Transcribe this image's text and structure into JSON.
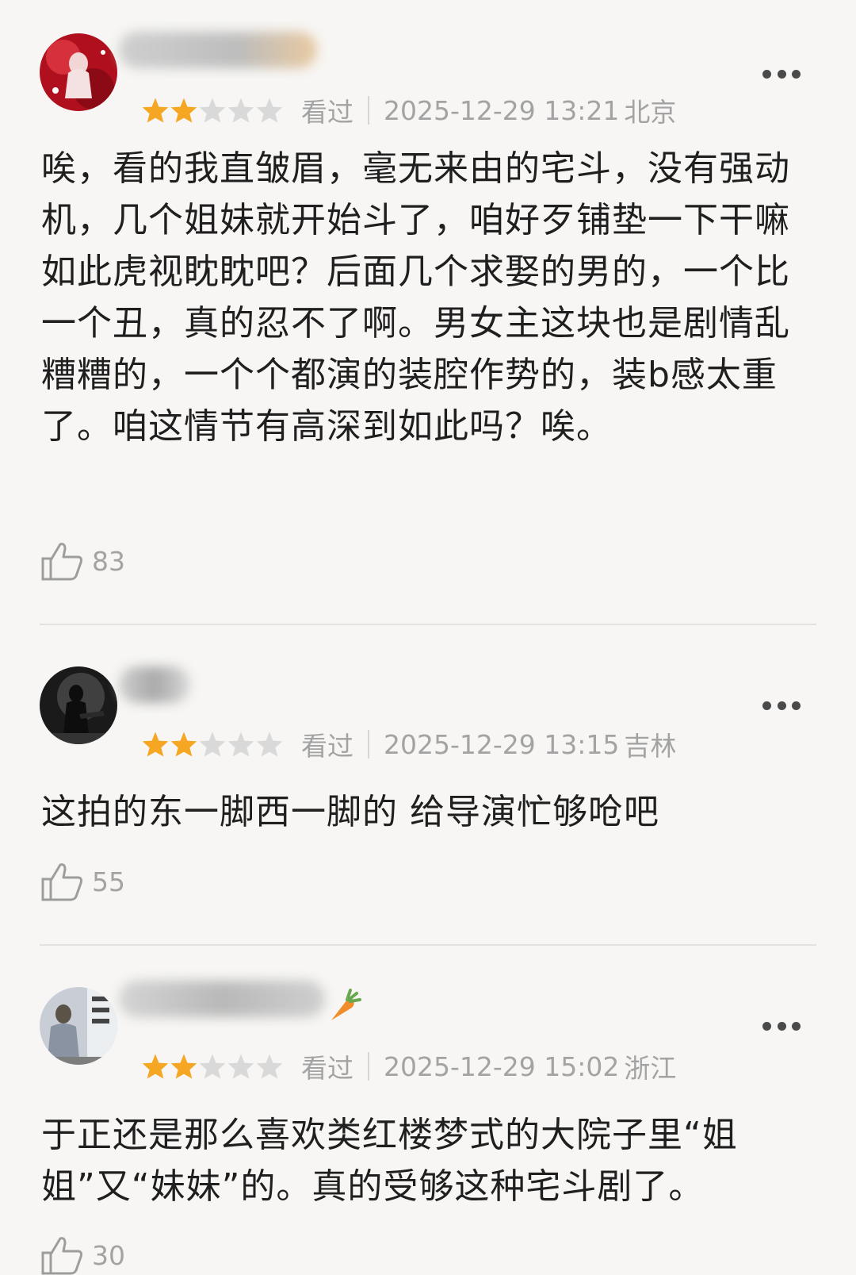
{
  "reviews": [
    {
      "rating": 2,
      "max_rating": 5,
      "status": "看过",
      "datetime": "2025-12-29 13:21",
      "location": "北京",
      "text": "唉，看的我直皱眉，毫无来由的宅斗，没有强动机，几个姐妹就开始斗了，咱好歹铺垫一下干嘛如此虎视眈眈吧？后面几个求娶的男的，一个比一个丑，真的忍不了啊。男女主这块也是剧情乱糟糟的，一个个都演的装腔作势的，装b感太重了。咱这情节有高深到如此吗？唉。",
      "likes": "83"
    },
    {
      "rating": 2,
      "max_rating": 5,
      "status": "看过",
      "datetime": "2025-12-29 13:15",
      "location": "吉林",
      "text": "这拍的东一脚西一脚的 给导演忙够呛吧",
      "likes": "55"
    },
    {
      "rating": 2,
      "max_rating": 5,
      "status": "看过",
      "datetime": "2025-12-29 15:02",
      "location": "浙江",
      "text": "于正还是那么喜欢类红楼梦式的大院子里“姐姐”又“妹妹”的。真的受够这种宅斗剧了。",
      "likes": "30"
    }
  ],
  "colors": {
    "star_filled": "#f5a623",
    "star_empty": "#d9d9d9",
    "meta_text": "#a3a3a3",
    "background": "#f7f6f4"
  },
  "icons": [
    "more-icon",
    "thumbs-up-icon",
    "star-icon",
    "carrot-icon"
  ]
}
